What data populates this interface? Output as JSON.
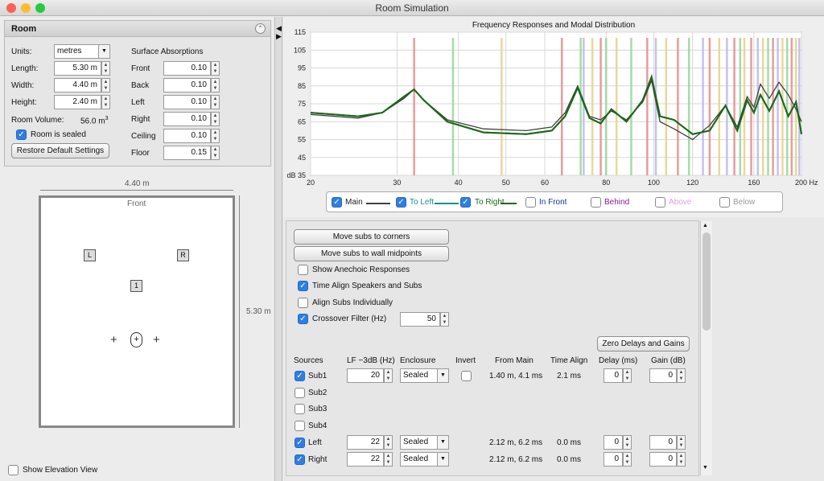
{
  "window": {
    "title": "Room Simulation"
  },
  "room": {
    "title": "Room",
    "units_label": "Units:",
    "units_value": "metres",
    "length_label": "Length:",
    "length_value": "5.30 m",
    "width_label": "Width:",
    "width_value": "4.40 m",
    "height_label": "Height:",
    "height_value": "2.40 m",
    "volume_label": "Room Volume:",
    "volume_value": "56.0 m",
    "volume_exp": "3",
    "sealed_label": "Room is sealed",
    "sealed_checked": true,
    "restore_label": "Restore Default Settings"
  },
  "absorption": {
    "title": "Surface Absorptions",
    "rows": [
      {
        "label": "Front",
        "value": "0.10"
      },
      {
        "label": "Back",
        "value": "0.10"
      },
      {
        "label": "Left",
        "value": "0.10"
      },
      {
        "label": "Right",
        "value": "0.10"
      },
      {
        "label": "Ceiling",
        "value": "0.10"
      },
      {
        "label": "Floor",
        "value": "0.15"
      }
    ]
  },
  "plan": {
    "width_dim": "4.40 m",
    "length_dim": "5.30 m",
    "front_label": "Front",
    "speaker_left": "L",
    "speaker_right": "R",
    "sub_one": "1",
    "elevation_label": "Show Elevation View",
    "elevation_checked": false
  },
  "chart_data": {
    "type": "line",
    "title": "Frequency Responses and Modal Distribution",
    "xscale": "log",
    "xlim": [
      20,
      200
    ],
    "ylim": [
      35,
      115
    ],
    "xticks": [
      "20",
      "30",
      "40",
      "50",
      "60",
      "80",
      "100",
      "120",
      "160",
      "200 Hz"
    ],
    "xtick_values": [
      20,
      30,
      40,
      50,
      60,
      80,
      100,
      120,
      160,
      200
    ],
    "yticks": [
      "115",
      "105",
      "95",
      "85",
      "75",
      "65",
      "55",
      "45",
      "dB 35"
    ],
    "ytick_values": [
      115,
      105,
      95,
      85,
      75,
      65,
      55,
      45,
      35
    ],
    "grid": true,
    "legend_position": "bottom",
    "series": [
      {
        "name": "Main",
        "color": "#404040",
        "x": [
          20,
          25,
          28,
          31,
          32.5,
          34,
          38,
          45,
          55,
          62,
          66,
          70,
          74,
          78,
          82,
          88,
          95,
          99,
          103,
          110,
          120,
          130,
          140,
          148,
          155,
          160,
          165,
          172,
          180,
          188,
          195,
          200
        ],
        "y": [
          69,
          67,
          70,
          78,
          83,
          77,
          66,
          61,
          60,
          62,
          70,
          85,
          68,
          66,
          71,
          66,
          76,
          88,
          65,
          61,
          55,
          63,
          74,
          62,
          79,
          73,
          86,
          78,
          87,
          80,
          72,
          65
        ]
      },
      {
        "name": "To Left",
        "color": "#1a6a1a",
        "x": [
          20,
          25,
          28,
          31,
          32.5,
          34,
          38,
          45,
          55,
          62,
          66,
          70,
          74,
          78,
          82,
          88,
          95,
          99,
          103,
          110,
          120,
          130,
          140,
          148,
          155,
          160,
          165,
          172,
          180,
          188,
          195,
          200
        ],
        "y": [
          70,
          68,
          70,
          79,
          83,
          77,
          65,
          59,
          58,
          60,
          68,
          84,
          67,
          64,
          72,
          65,
          77,
          90,
          68,
          66,
          58,
          60,
          74,
          60,
          77,
          70,
          80,
          71,
          82,
          68,
          76,
          58
        ]
      },
      {
        "name": "To Right",
        "color": "#1a6a1a",
        "x": [
          20,
          25,
          28,
          31,
          32.5,
          34,
          38,
          45,
          55,
          62,
          66,
          70,
          74,
          78,
          82,
          88,
          95,
          99,
          103,
          110,
          120,
          130,
          140,
          148,
          155,
          160,
          165,
          172,
          180,
          188,
          195,
          200
        ],
        "y": [
          70,
          68,
          70,
          79,
          83,
          77,
          65,
          59,
          58,
          60,
          68,
          84,
          67,
          64,
          72,
          65,
          77,
          90,
          68,
          66,
          58,
          60,
          74,
          60,
          77,
          70,
          80,
          71,
          82,
          68,
          76,
          58
        ]
      },
      {
        "name": "In Front",
        "color": "#1c2fb0"
      },
      {
        "name": "Behind",
        "color": "#8a1a8a"
      },
      {
        "name": "Above",
        "color": "#e0a0e0"
      },
      {
        "name": "Below",
        "color": "#999999"
      }
    ],
    "modes": [
      {
        "f": 32.5,
        "color": "#e58b8b"
      },
      {
        "f": 39,
        "color": "#9ad49a"
      },
      {
        "f": 49,
        "color": "#e8d089"
      },
      {
        "f": 65,
        "color": "#e58b8b"
      },
      {
        "f": 71,
        "color": "#9ad49a"
      },
      {
        "f": 72,
        "color": "#b8b8e8"
      },
      {
        "f": 75,
        "color": "#e8d089"
      },
      {
        "f": 78,
        "color": "#e58b8b"
      },
      {
        "f": 80,
        "color": "#9ad49a"
      },
      {
        "f": 84,
        "color": "#e8d089"
      },
      {
        "f": 90,
        "color": "#9ad49a"
      },
      {
        "f": 97,
        "color": "#e58b8b"
      },
      {
        "f": 101,
        "color": "#b8b8e8"
      },
      {
        "f": 106,
        "color": "#e8d089"
      },
      {
        "f": 112,
        "color": "#e58b8b"
      },
      {
        "f": 118,
        "color": "#9ad49a"
      },
      {
        "f": 126,
        "color": "#b8b8e8"
      },
      {
        "f": 130,
        "color": "#e58b8b"
      },
      {
        "f": 136,
        "color": "#e8d089"
      },
      {
        "f": 141,
        "color": "#b8b8e8"
      },
      {
        "f": 146,
        "color": "#e58b8b"
      },
      {
        "f": 150,
        "color": "#9ad49a"
      },
      {
        "f": 153,
        "color": "#e8d089"
      },
      {
        "f": 158,
        "color": "#e58b8b"
      },
      {
        "f": 163,
        "color": "#b8b8e8"
      },
      {
        "f": 167,
        "color": "#e8d089"
      },
      {
        "f": 171,
        "color": "#9ad49a"
      },
      {
        "f": 175,
        "color": "#e58b8b"
      },
      {
        "f": 179,
        "color": "#b8b8e8"
      },
      {
        "f": 183,
        "color": "#e8d089"
      },
      {
        "f": 187,
        "color": "#9ad49a"
      },
      {
        "f": 191,
        "color": "#e58b8b"
      },
      {
        "f": 195,
        "color": "#e8d089"
      },
      {
        "f": 198,
        "color": "#b8b8e8"
      }
    ]
  },
  "legend": {
    "main": "Main",
    "to_left": "To Left",
    "to_right": "To Right",
    "in_front": "In Front",
    "behind": "Behind",
    "above": "Above",
    "below": "Below"
  },
  "controls": {
    "move_corners": "Move subs to corners",
    "move_midpoints": "Move subs to wall midpoints",
    "show_anechoic": "Show Anechoic Responses",
    "show_anechoic_checked": false,
    "time_align": "Time Align Speakers and Subs",
    "time_align_checked": true,
    "align_subs": "Align Subs Individually",
    "align_subs_checked": false,
    "crossover": "Crossover Filter (Hz)",
    "crossover_checked": true,
    "crossover_value": "50",
    "zero_delays": "Zero Delays and Gains"
  },
  "sources_table": {
    "headers": [
      "Sources",
      "LF −3dB (Hz)",
      "Enclosure",
      "Invert",
      "From Main",
      "Time Align",
      "Delay (ms)",
      "Gain (dB)"
    ],
    "rows": [
      {
        "name": "Sub1",
        "checked": true,
        "lf": "20",
        "enclosure": "Sealed",
        "from_main": "1.40 m, 4.1 ms",
        "time_align": "2.1 ms",
        "delay": "0",
        "gain": "0"
      },
      {
        "name": "Sub2",
        "checked": false
      },
      {
        "name": "Sub3",
        "checked": false
      },
      {
        "name": "Sub4",
        "checked": false
      },
      {
        "name": "Left",
        "checked": true,
        "lf": "22",
        "enclosure": "Sealed",
        "from_main": "2.12 m, 6.2 ms",
        "time_align": "0.0 ms",
        "delay": "0",
        "gain": "0"
      },
      {
        "name": "Right",
        "checked": true,
        "lf": "22",
        "enclosure": "Sealed",
        "from_main": "2.12 m, 6.2 ms",
        "time_align": "0.0 ms",
        "delay": "0",
        "gain": "0"
      }
    ]
  }
}
